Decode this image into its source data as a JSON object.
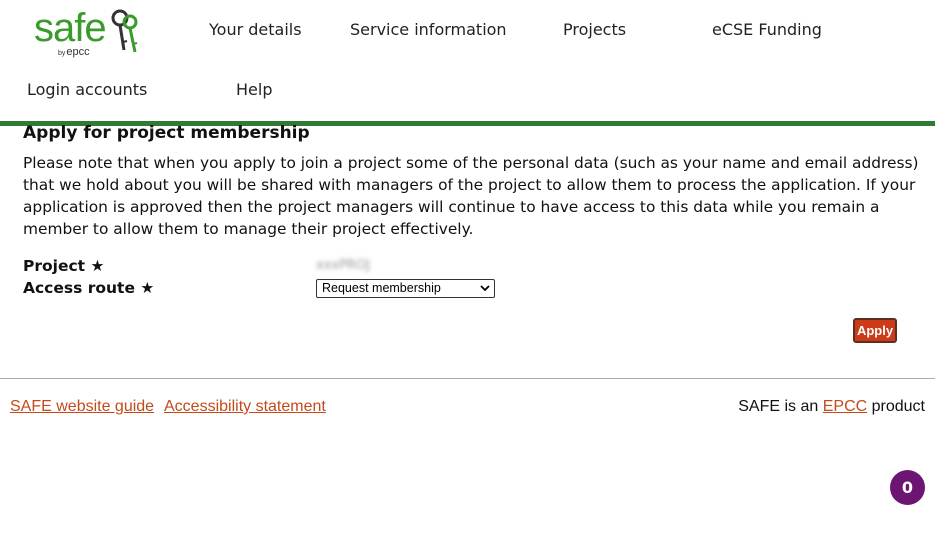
{
  "header": {
    "logo": {
      "word": "safe",
      "by": "by",
      "org": "epcc"
    },
    "nav_row1": [
      {
        "label": "Your details"
      },
      {
        "label": "Service information"
      },
      {
        "label": "Projects"
      },
      {
        "label": "eCSE Funding"
      }
    ],
    "nav_row2": [
      {
        "label": "Login accounts"
      },
      {
        "label": "Help"
      }
    ]
  },
  "main": {
    "title": "Apply for project membership",
    "notice": "Please note that when you apply to join a project some of the personal data (such as your name and email address) that we hold about you will be shared with managers of the project to allow them to process the application. If your application is approved then the project managers will continue to have access to this data while you remain a member to allow them to manage their project effectively.",
    "form": {
      "project_label": "Project ★",
      "project_value": "xxxPROJ",
      "access_route_label": "Access route ★",
      "access_route_selected": "Request membership",
      "apply_label": "Apply"
    }
  },
  "footer": {
    "guide_link": "SAFE website guide",
    "accessibility_link": "Accessibility statement",
    "product_prefix": "SAFE is an",
    "product_link": "EPCC",
    "product_suffix": "product"
  },
  "notification_count": "0",
  "colors": {
    "brand_green": "#2d7b34",
    "link": "#c34a1b",
    "apply_button": "#cc3a1a",
    "badge": "#6d1572"
  }
}
